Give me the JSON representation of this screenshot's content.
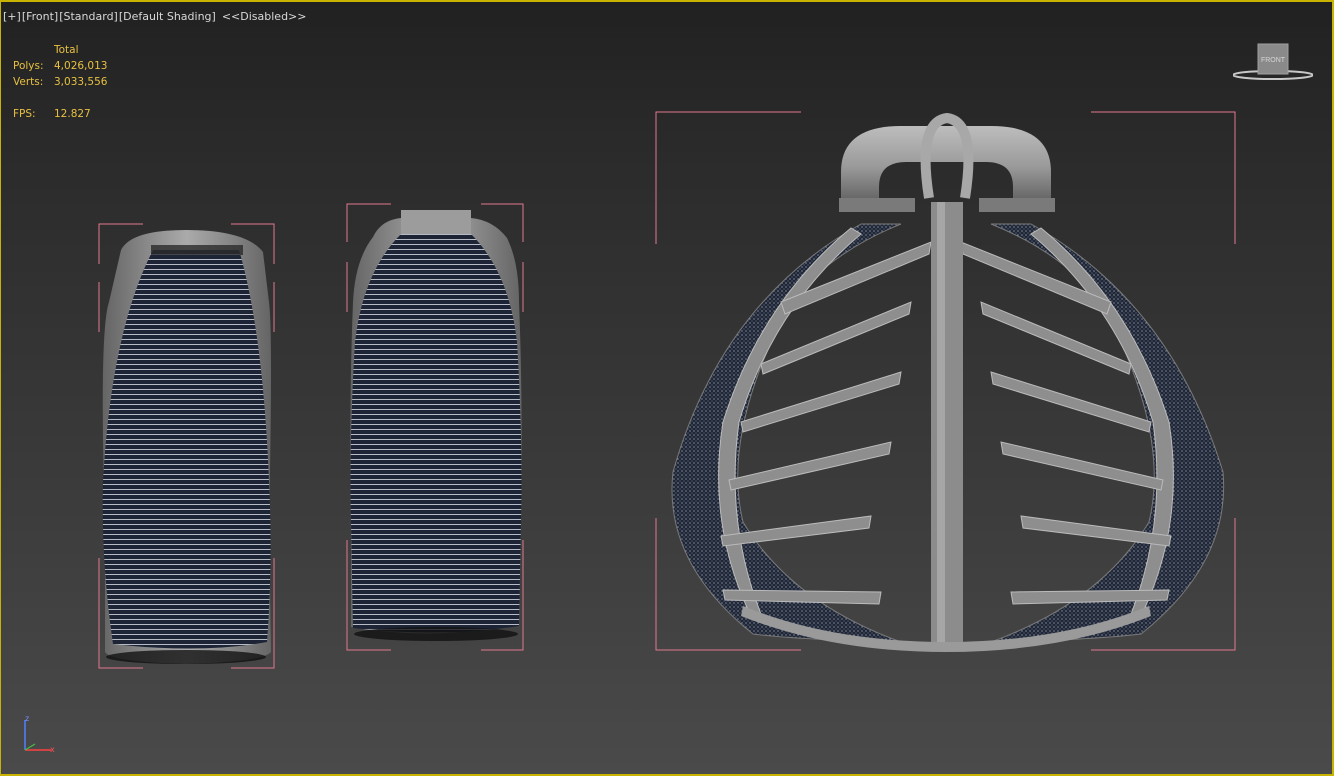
{
  "viewport": {
    "label_parts": [
      "[+]",
      "[Front]",
      "[Standard]",
      "[Default Shading]",
      "<<Disabled>>"
    ]
  },
  "stats": {
    "header": "Total",
    "polys_label": "Polys:",
    "polys_value": "4,026,013",
    "verts_label": "Verts:",
    "verts_value": "3,033,556",
    "fps_label": "FPS:",
    "fps_value": "12.827"
  },
  "viewcube": {
    "face_label": "FRONT"
  },
  "axis": {
    "z_label": "z",
    "x_label": "x"
  },
  "colors": {
    "viewport_border": "#c8b400",
    "stats_text": "#e8c040",
    "selection_bracket": "#e07890",
    "mesh_fill": "#1c2436",
    "shell_gray": "#8a8a8a"
  }
}
